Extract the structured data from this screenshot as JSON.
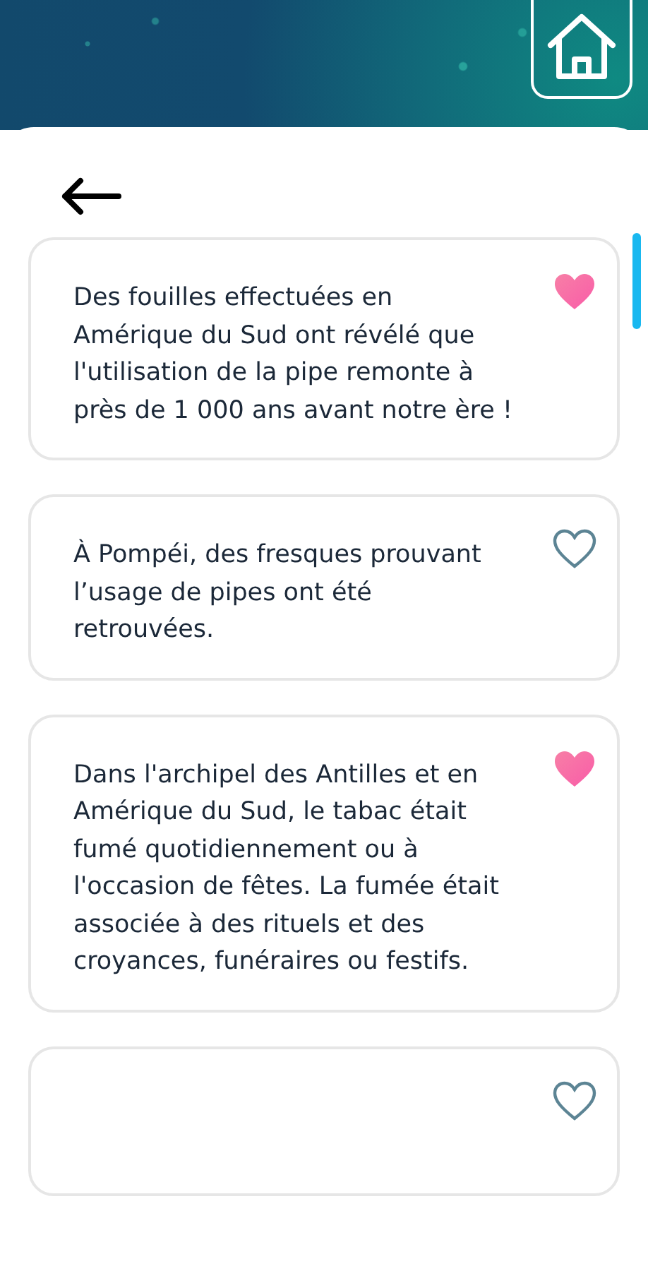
{
  "facts": [
    {
      "text": "Des fouilles effectuées en Amérique du Sud ont révélé que l'utilisation de la pipe remonte à près de 1 000 ans avant notre ère !",
      "favorite": true
    },
    {
      "text": "À Pompéi, des fresques prouvant l’usage de pipes ont été retrouvées.",
      "favorite": false
    },
    {
      "text": "Dans l'archipel des Antilles et en Amérique du Sud, le tabac était fumé quotidiennement ou à l'occasion de fêtes. La fumée était associée à des rituels et des croyances, funéraires ou festifs.",
      "favorite": true
    },
    {
      "favorite": false
    }
  ]
}
